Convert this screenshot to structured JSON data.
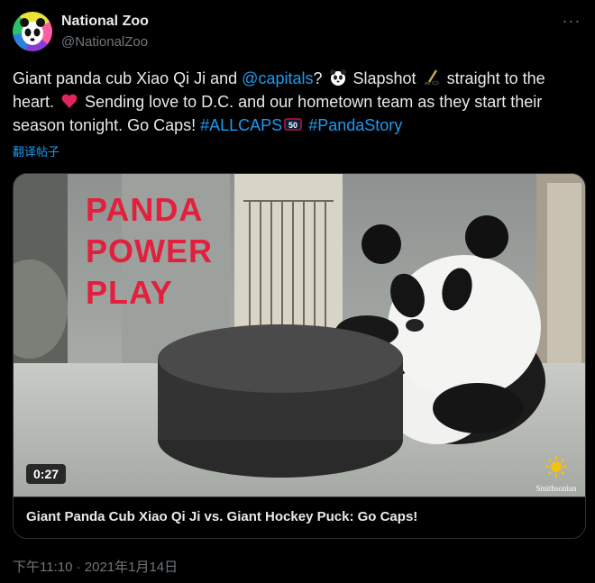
{
  "author": {
    "name": "National Zoo",
    "handle": "@NationalZoo"
  },
  "tweet": {
    "part1": "Giant panda cub Xiao Qi Ji and ",
    "mention": "@capitals",
    "part2": "? ",
    "part3": " Slapshot ",
    "part4": " straight to the heart. ",
    "part5": " Sending love to D.C. and our hometown team as they start their season tonight. Go Caps! ",
    "hashtag1": "#ALLCAPS",
    "hashtag2": "#PandaStory",
    "icons": [
      "panda-emoji",
      "hockey-emoji",
      "heart-emoji",
      "caps-50-emoji"
    ]
  },
  "translate_label": "翻译帖子",
  "video": {
    "overlay_lines": [
      "PANDA",
      "POWER",
      "PLAY"
    ],
    "duration": "0:27",
    "watermark": "Smithsonian",
    "title": "Giant Panda Cub Xiao Qi Ji vs. Giant Hockey Puck: Go Caps!"
  },
  "timestamp": "下午11:10 · 2021年1月14日",
  "colors": {
    "accent": "#1d9bf0",
    "overlay_red": "#e21f3c",
    "background": "#000000"
  }
}
